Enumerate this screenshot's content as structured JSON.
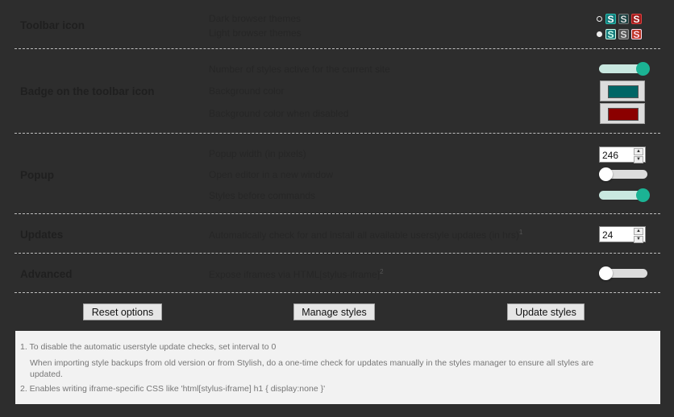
{
  "sections": {
    "toolbar_icon": {
      "title": "Toolbar icon",
      "dark_label": "Dark browser themes",
      "light_label": "Light browser themes",
      "icon_glyph": "S"
    },
    "badge": {
      "title": "Badge on the toolbar icon",
      "count_label": "Number of styles active for the current site",
      "count_enabled": true,
      "bg_label": "Background color",
      "bg_color": "#006666",
      "bg_disabled_label": "Background color when disabled",
      "bg_disabled_color": "#8b0000"
    },
    "popup": {
      "title": "Popup",
      "width_label": "Popup width (in pixels)",
      "width_value": "246",
      "editor_label": "Open editor in a new window",
      "editor_enabled": false,
      "before_label": "Styles before commands",
      "before_enabled": true
    },
    "updates": {
      "title": "Updates",
      "interval_label": "Automatically check for and install all available userstyle updates (in hrs)",
      "interval_sup": "1",
      "interval_value": "24"
    },
    "advanced": {
      "title": "Advanced",
      "iframe_label": "Expose iframes via HTML[stylus-iframe]",
      "iframe_sup": "2",
      "iframe_enabled": false
    }
  },
  "buttons": {
    "reset": "Reset options",
    "manage": "Manage styles",
    "update": "Update styles"
  },
  "notes": {
    "note1": "1. To disable the automatic userstyle update checks, set interval to 0",
    "note1b": "When importing style backups from old version or from Stylish, do a one-time check for updates manually in the styles manager to ensure all styles are updated.",
    "note2": "2. Enables writing iframe-specific CSS like 'html[stylus-iframe] h1 { display:none }'"
  },
  "colors": {
    "accent": "#1bb394",
    "background": "#2d2d2d"
  }
}
